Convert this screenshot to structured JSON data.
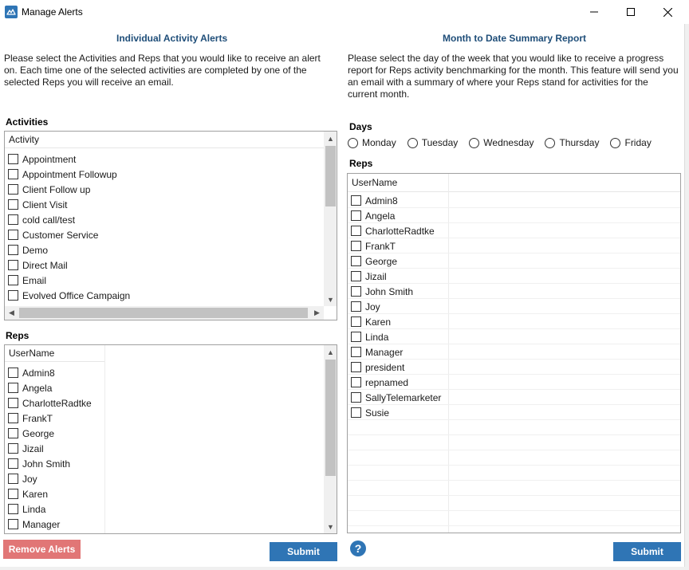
{
  "window": {
    "title": "Manage Alerts"
  },
  "individual": {
    "title": "Individual Activity Alerts",
    "description": "Please select the Activities and Reps that you would like to receive an alert on.  Each time one of the selected activities are completed by one of the selected Reps you will receive an email.",
    "activities_label": "Activities",
    "activity_header": "Activity",
    "activities": [
      "Appointment",
      "Appointment Followup",
      "Client Follow up",
      "Client Visit",
      "cold call/test",
      "Customer Service",
      "Demo",
      "Direct Mail",
      "Email",
      "Evolved Office Campaign"
    ],
    "reps_label": "Reps",
    "reps_header": "UserName",
    "reps": [
      "Admin8",
      "Angela",
      "CharlotteRadtke",
      "FrankT",
      "George",
      "Jizail",
      "John Smith",
      "Joy",
      "Karen",
      "Linda",
      "Manager"
    ],
    "remove_label": "Remove Alerts",
    "submit_label": "Submit"
  },
  "summary": {
    "title": "Month to Date Summary Report",
    "description": "Please select the day of the week that you would like to receive a progress report for Reps activity benchmarking for the month.  This feature will send you an email with a summary of where your Reps stand for activities for the current month.",
    "days_label": "Days",
    "days": [
      "Monday",
      "Tuesday",
      "Wednesday",
      "Thursday",
      "Friday"
    ],
    "reps_label": "Reps",
    "reps_header": "UserName",
    "reps": [
      "Admin8",
      "Angela",
      "CharlotteRadtke",
      "FrankT",
      "George",
      "Jizail",
      "John Smith",
      "Joy",
      "Karen",
      "Linda",
      "Manager",
      "president",
      "repnamed",
      "SallyTelemarketer",
      "Susie"
    ],
    "help_glyph": "?",
    "submit_label": "Submit"
  },
  "icons": {
    "app": "cloud-app-icon",
    "help": "question-icon"
  },
  "colors": {
    "title_blue": "#1f4e79",
    "submit_blue": "#2f75b5",
    "remove_red": "#e17676"
  }
}
